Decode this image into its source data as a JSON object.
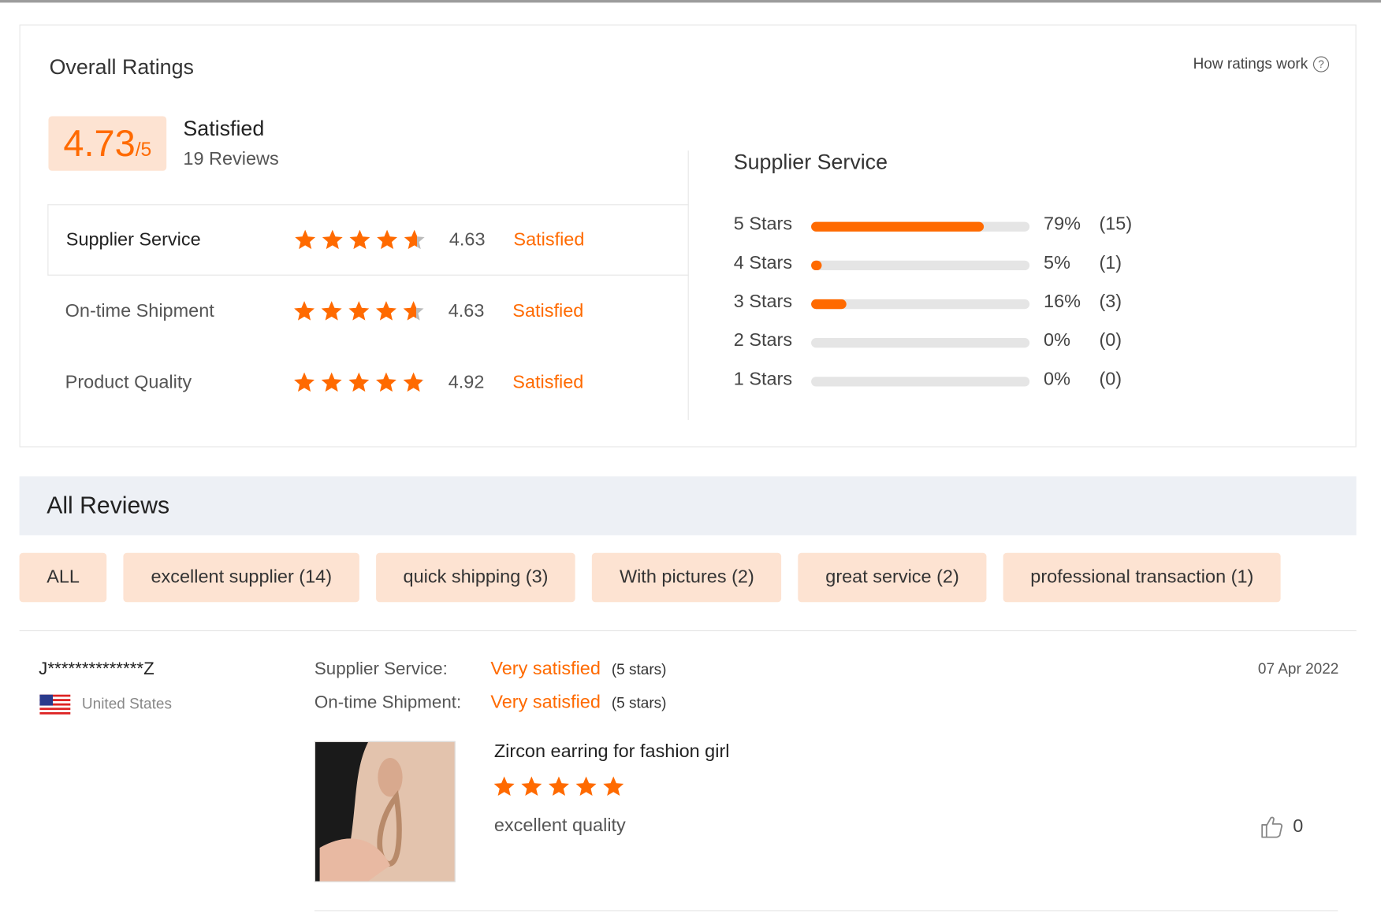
{
  "overall": {
    "title": "Overall Ratings",
    "how_link": "How ratings work",
    "score": "4.73",
    "score_den": "/5",
    "label": "Satisfied",
    "review_count": "19 Reviews"
  },
  "categories": [
    {
      "name": "Supplier Service",
      "score": "4.63",
      "label": "Satisfied",
      "stars": 4.63
    },
    {
      "name": "On-time Shipment",
      "score": "4.63",
      "label": "Satisfied",
      "stars": 4.63
    },
    {
      "name": "Product Quality",
      "score": "4.92",
      "label": "Satisfied",
      "stars": 4.92
    }
  ],
  "distribution": {
    "title": "Supplier Service",
    "rows": [
      {
        "label": "5  Stars",
        "pct": "79%",
        "count": "(15)",
        "fill": 0.79
      },
      {
        "label": "4  Stars",
        "pct": "5%",
        "count": "(1)",
        "fill": 0.05
      },
      {
        "label": "3  Stars",
        "pct": "16%",
        "count": "(3)",
        "fill": 0.16
      },
      {
        "label": "2  Stars",
        "pct": "0%",
        "count": "(0)",
        "fill": 0
      },
      {
        "label": "1  Stars",
        "pct": "0%",
        "count": "(0)",
        "fill": 0
      }
    ]
  },
  "all_reviews": {
    "title": "All Reviews",
    "filters": [
      "ALL",
      "excellent supplier (14)",
      "quick shipping (3)",
      "With pictures (2)",
      "great service (2)",
      "professional transaction (1)"
    ]
  },
  "review": {
    "reviewer": "J**************Z",
    "country": "United States",
    "date": "07 Apr 2022",
    "supplier_label": "Supplier Service:",
    "supplier_value": "Very satisfied",
    "supplier_stars": "(5 stars)",
    "shipment_label": "On-time Shipment:",
    "shipment_value": "Very satisfied",
    "shipment_stars": "(5 stars)",
    "product_title": "Zircon earring for fashion girl",
    "product_rating": 5,
    "text": "excellent quality",
    "likes": "0"
  },
  "colors": {
    "accent": "#ff6a00",
    "chip_bg": "#fde3d2",
    "bar_bg": "#e5e5e5"
  }
}
